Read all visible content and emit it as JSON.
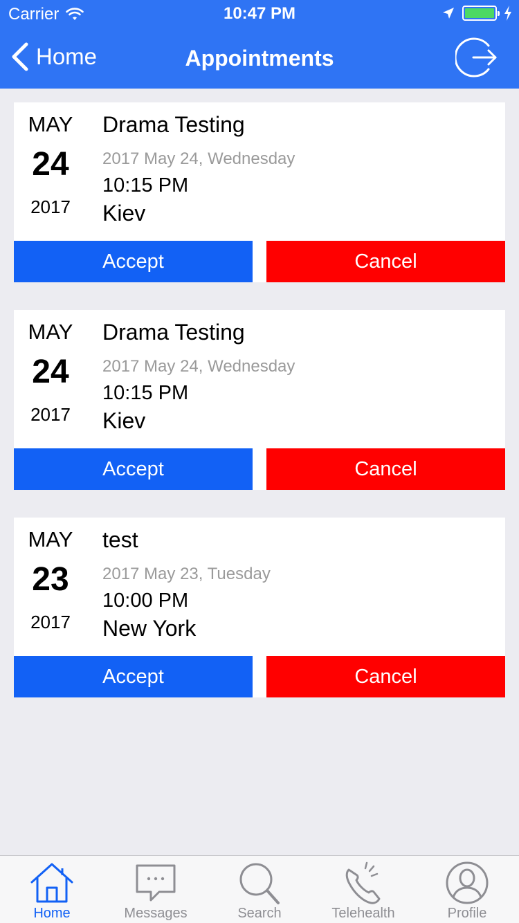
{
  "status_bar": {
    "carrier": "Carrier",
    "time": "10:47 PM"
  },
  "nav": {
    "back_label": "Home",
    "title": "Appointments"
  },
  "appointments": [
    {
      "month": "MAY",
      "day": "24",
      "year": "2017",
      "title": "Drama Testing",
      "full_date": "2017 May 24, Wednesday",
      "time": "10:15 PM",
      "location": "Kiev",
      "accept_label": "Accept",
      "cancel_label": "Cancel"
    },
    {
      "month": "MAY",
      "day": "24",
      "year": "2017",
      "title": "Drama Testing",
      "full_date": "2017 May 24, Wednesday",
      "time": "10:15 PM",
      "location": "Kiev",
      "accept_label": "Accept",
      "cancel_label": "Cancel"
    },
    {
      "month": "MAY",
      "day": "23",
      "year": "2017",
      "title": "test",
      "full_date": "2017 May 23, Tuesday",
      "time": "10:00 PM",
      "location": "New York",
      "accept_label": "Accept",
      "cancel_label": "Cancel"
    }
  ],
  "tabs": [
    {
      "label": "Home",
      "icon": "home-icon",
      "active": true
    },
    {
      "label": "Messages",
      "icon": "chat-bubble-icon",
      "active": false
    },
    {
      "label": "Search",
      "icon": "search-icon",
      "active": false
    },
    {
      "label": "Telehealth",
      "icon": "phone-icon",
      "active": false
    },
    {
      "label": "Profile",
      "icon": "profile-icon",
      "active": false
    }
  ],
  "colors": {
    "header": "#2f74f4",
    "accept": "#1261f5",
    "cancel": "#ff0000",
    "tab_active": "#1261f5",
    "tab_inactive": "#8e8e93",
    "battery": "#4cd964"
  }
}
